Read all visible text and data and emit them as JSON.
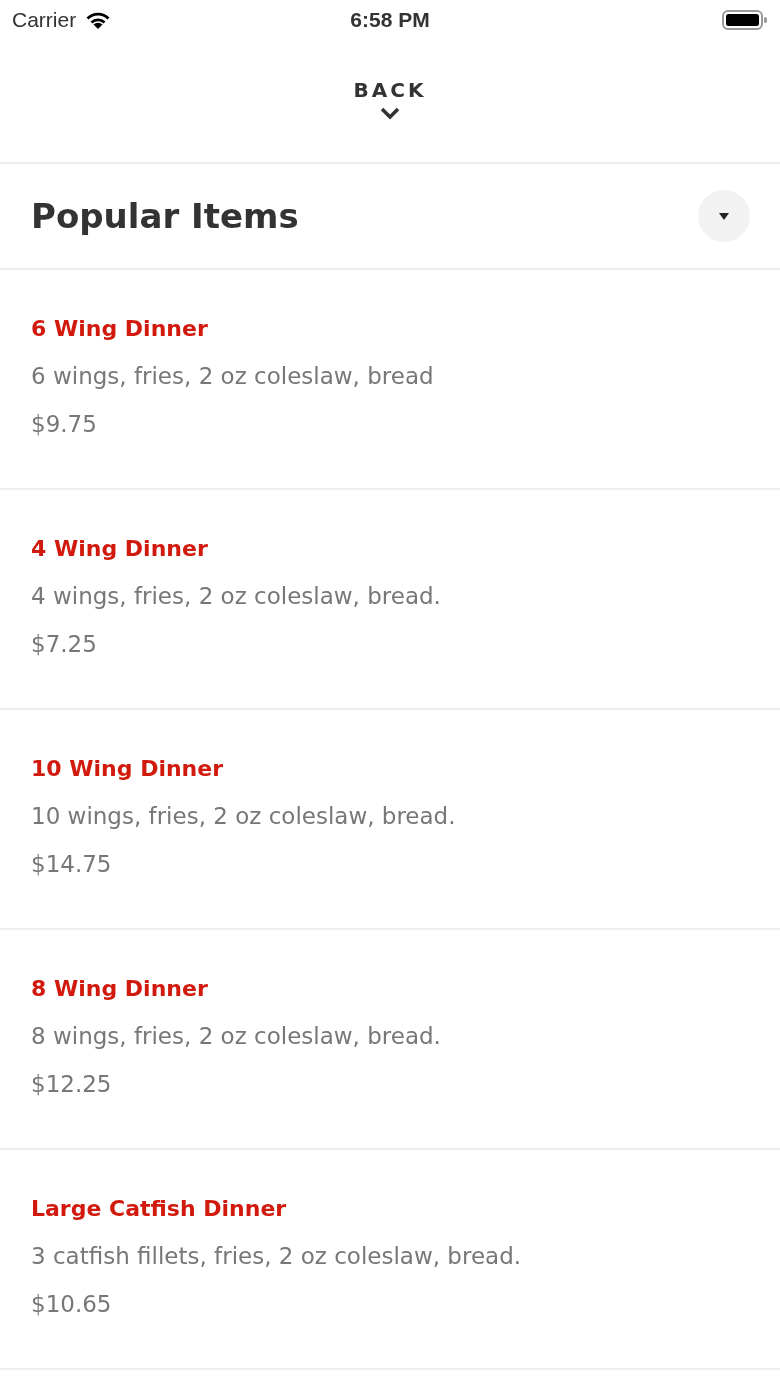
{
  "status_bar": {
    "carrier": "Carrier",
    "time": "6:58 PM"
  },
  "nav": {
    "back_label": "BACK"
  },
  "section": {
    "title": "Popular Items",
    "expanded": true
  },
  "items": [
    {
      "name": "6 Wing Dinner",
      "description": "6 wings, fries, 2 oz coleslaw, bread",
      "price": "$9.75"
    },
    {
      "name": "4 Wing Dinner",
      "description": "4 wings, fries, 2 oz coleslaw, bread.",
      "price": "$7.25"
    },
    {
      "name": "10 Wing Dinner",
      "description": "10 wings, fries, 2 oz coleslaw, bread.",
      "price": "$14.75"
    },
    {
      "name": "8 Wing Dinner",
      "description": "8 wings, fries, 2 oz coleslaw, bread.",
      "price": "$12.25"
    },
    {
      "name": "Large Catfish Dinner",
      "description": "3 catfish fillets, fries, 2 oz coleslaw, bread.",
      "price": "$10.65"
    }
  ]
}
